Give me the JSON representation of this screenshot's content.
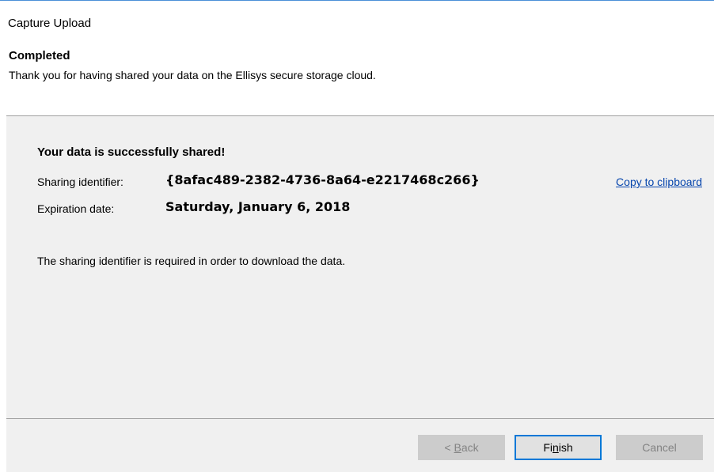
{
  "window": {
    "title": "Capture Upload"
  },
  "header": {
    "heading": "Completed",
    "subtitle": "Thank you for having shared your data on the Ellisys secure storage cloud."
  },
  "content": {
    "success_message": "Your data is successfully shared!",
    "sharing_identifier_label": "Sharing identifier:",
    "sharing_identifier_value": "{8afac489-2382-4736-8a64-e2217468c266}",
    "copy_link": "Copy to clipboard",
    "expiration_label": "Expiration date:",
    "expiration_value": "Saturday, January 6, 2018",
    "note": "The sharing identifier is required in order to download the data."
  },
  "footer": {
    "back": {
      "pre": "< ",
      "mnemonic": "B",
      "post": "ack",
      "enabled": false
    },
    "finish": {
      "pre": "Fi",
      "mnemonic": "n",
      "post": "ish",
      "enabled": true
    },
    "cancel": {
      "label": "Cancel",
      "enabled": false
    }
  },
  "colors": {
    "link": "#0645ad",
    "panel_bg": "#f0f0f0",
    "focus_border": "#0078d7"
  }
}
